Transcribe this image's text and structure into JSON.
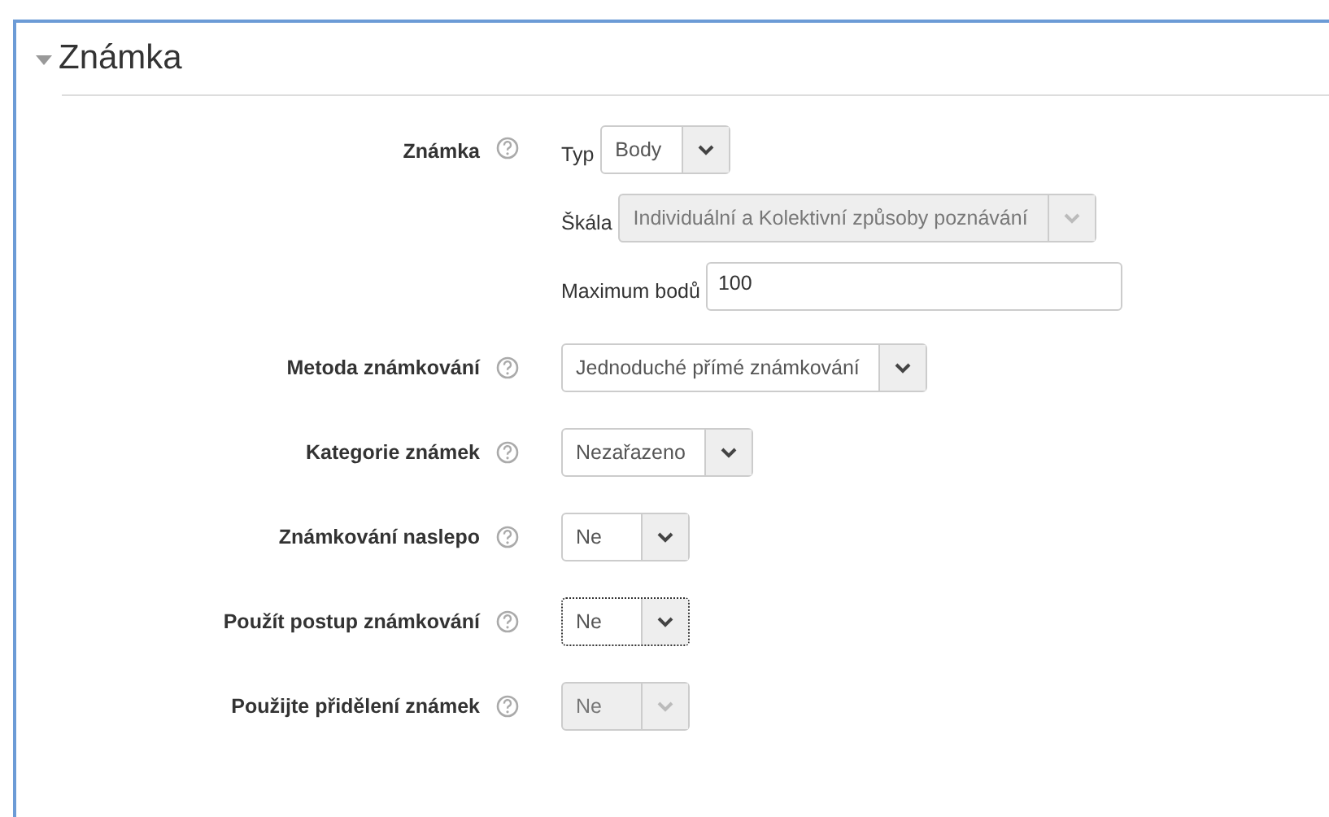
{
  "section": {
    "title": "Známka",
    "expanded": true
  },
  "grade": {
    "label": "Známka",
    "fields": [
      {
        "kind": "select",
        "label": "Typ",
        "value": "Body",
        "disabled": false
      },
      {
        "kind": "select",
        "label": "Škála",
        "value": "Individuální a Kolektivní způsoby poznávání",
        "disabled": true
      },
      {
        "kind": "input",
        "label": "Maximum bodů",
        "value": "100",
        "disabled": false
      }
    ]
  },
  "rows": [
    {
      "label": "Metoda známkování",
      "value": "Jednoduché přímé známkování",
      "disabled": false,
      "focused": false
    },
    {
      "label": "Kategorie známek",
      "value": "Nezařazeno",
      "disabled": false,
      "focused": false
    },
    {
      "label": "Známkování naslepo",
      "value": "Ne",
      "disabled": false,
      "focused": false
    },
    {
      "label": "Použít postup známkování",
      "value": "Ne",
      "disabled": false,
      "focused": true
    },
    {
      "label": "Použijte přidělení známek",
      "value": "Ne",
      "disabled": true,
      "focused": false
    }
  ]
}
